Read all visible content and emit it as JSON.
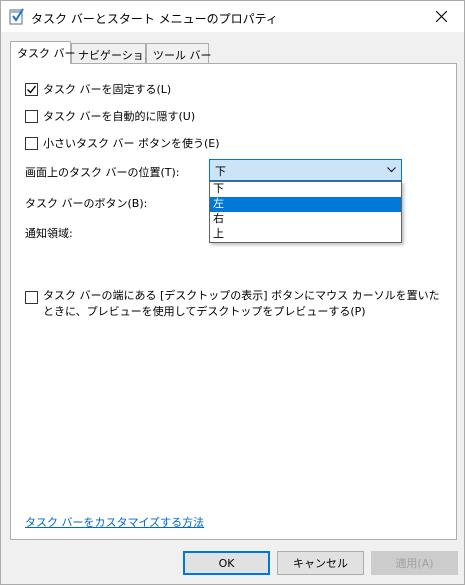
{
  "window": {
    "title": "タスク バーとスタート メニューのプロパティ",
    "icon": "taskbar-properties-icon",
    "close": "close-icon"
  },
  "tabs": [
    {
      "label": "タスク バー",
      "active": true
    },
    {
      "label": "ナビゲーション",
      "active": false
    },
    {
      "label": "ツール バー",
      "active": false
    }
  ],
  "options": {
    "lock_taskbar": {
      "label": "タスク バーを固定する(L)",
      "checked": true
    },
    "auto_hide": {
      "label": "タスク バーを自動的に隠す(U)",
      "checked": false
    },
    "small_buttons": {
      "label": "小さいタスク バー ボタンを使う(E)",
      "checked": false
    }
  },
  "position": {
    "label": "画面上のタスク バーの位置(T):",
    "value": "下",
    "options": [
      "下",
      "左",
      "右",
      "上"
    ],
    "highlighted": "左"
  },
  "buttons_label": "タスク バーのボタン(B):",
  "notification_label": "通知領域:",
  "peek": {
    "label": "タスク バーの端にある [デスクトップの表示] ボタンにマウス カーソルを置いたときに、プレビューを使用してデスクトップをプレビューする(P)",
    "checked": false
  },
  "customize_link": "タスク バーをカスタマイズする方法",
  "footer": {
    "ok": "OK",
    "cancel": "キャンセル",
    "apply": "適用(A)"
  },
  "colors": {
    "accent": "#0078d7",
    "link": "#0066cc",
    "dialog_bg": "#f0f0f0"
  }
}
